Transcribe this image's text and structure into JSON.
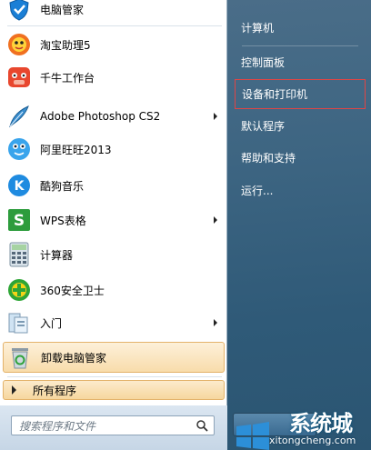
{
  "left_menu": {
    "items": [
      {
        "label": "电脑管家",
        "icon": "tencent-pc-manager-icon",
        "arrow": false
      },
      {
        "label": "淘宝助理5",
        "icon": "taobao-assistant-icon",
        "arrow": false
      },
      {
        "label": "千牛工作台",
        "icon": "qianniu-workbench-icon",
        "arrow": false
      },
      {
        "label": "Adobe Photoshop CS2",
        "icon": "photoshop-feather-icon",
        "arrow": true
      },
      {
        "label": "阿里旺旺2013",
        "icon": "aliwangwang-icon",
        "arrow": false
      },
      {
        "label": "酷狗音乐",
        "icon": "kugou-music-icon",
        "arrow": false
      },
      {
        "label": "WPS表格",
        "icon": "wps-spreadsheet-icon",
        "arrow": true
      },
      {
        "label": "计算器",
        "icon": "calculator-icon",
        "arrow": false
      },
      {
        "label": "360安全卫士",
        "icon": "360-safe-guard-icon",
        "arrow": false
      },
      {
        "label": "入门",
        "icon": "getting-started-icon",
        "arrow": true
      },
      {
        "label": "卸载电脑管家",
        "icon": "recycle-bin-icon",
        "arrow": false
      }
    ],
    "all_programs": "所有程序",
    "search_placeholder": "搜索程序和文件"
  },
  "right_menu": {
    "items": [
      {
        "label": "计算机"
      },
      {
        "label": "控制面板"
      },
      {
        "label": "设备和打印机"
      },
      {
        "label": "默认程序"
      },
      {
        "label": "帮助和支持"
      },
      {
        "label": "运行..."
      }
    ]
  },
  "watermark": {
    "text": "xitongcheng.com",
    "brand": "系统城"
  },
  "colors": {
    "highlight_border": "#e3b26a",
    "selection_box": "#e04545",
    "right_panel": "#3d6582"
  }
}
